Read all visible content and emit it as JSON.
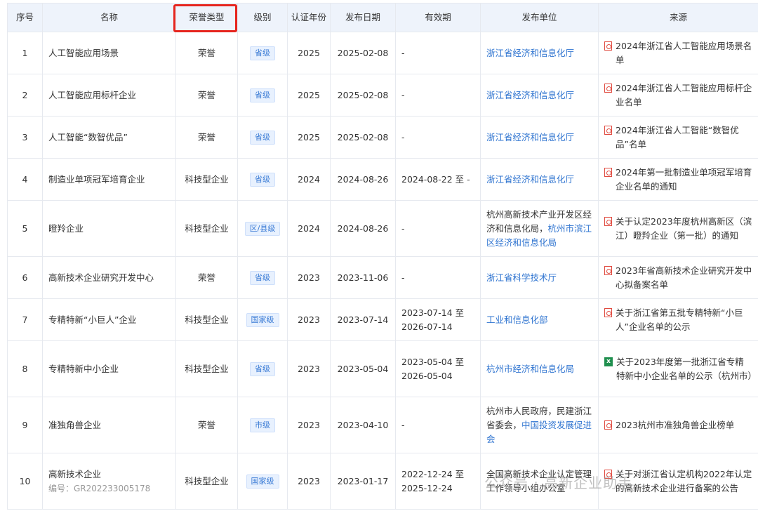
{
  "headers": [
    "序号",
    "名称",
    "荣誉类型",
    "级别",
    "认证年份",
    "发布日期",
    "有效期",
    "发布单位",
    "来源"
  ],
  "rows": [
    {
      "idx": "1",
      "name": "人工智能应用场景",
      "type": "荣誉",
      "level": "省级",
      "year": "2025",
      "date": "2025-02-08",
      "valid": "-",
      "issuer_plain": "",
      "issuer_link": "浙江省经济和信息化厅",
      "source_icon": "pdf-icon",
      "source": "2024年浙江省人工智能应用场景名单"
    },
    {
      "idx": "2",
      "name": "人工智能应用标杆企业",
      "type": "荣誉",
      "level": "省级",
      "year": "2025",
      "date": "2025-02-08",
      "valid": "-",
      "issuer_plain": "",
      "issuer_link": "浙江省经济和信息化厅",
      "source_icon": "pdf-icon",
      "source": "2024年浙江省人工智能应用标杆企业名单"
    },
    {
      "idx": "3",
      "name": "人工智能“数智优品”",
      "type": "荣誉",
      "level": "省级",
      "year": "2025",
      "date": "2025-02-08",
      "valid": "-",
      "issuer_plain": "",
      "issuer_link": "浙江省经济和信息化厅",
      "source_icon": "pdf-icon",
      "source": "2024年浙江省人工智能“数智优品”名单"
    },
    {
      "idx": "4",
      "name": "制造业单项冠军培育企业",
      "type": "科技型企业",
      "level": "省级",
      "year": "2024",
      "date": "2024-08-26",
      "valid": "2024-08-22 至 -",
      "issuer_plain": "",
      "issuer_link": "浙江省经济和信息化厅",
      "source_icon": "pdf-icon",
      "source": "2024年第一批制造业单项冠军培育企业名单的通知"
    },
    {
      "idx": "5",
      "name": "瞪羚企业",
      "type": "科技型企业",
      "level": "区/县级",
      "year": "2024",
      "date": "2024-08-26",
      "valid": "-",
      "issuer_plain": "杭州高新技术产业开发区经济和信息化局，",
      "issuer_link": "杭州市滨江区经济和信息化局",
      "source_icon": "pdf-icon",
      "source": "关于认定2023年度杭州高新区（滨江）瞪羚企业（第一批）的通知"
    },
    {
      "idx": "6",
      "name": "高新技术企业研究开发中心",
      "type": "荣誉",
      "level": "省级",
      "year": "2023",
      "date": "2023-11-06",
      "valid": "-",
      "issuer_plain": "",
      "issuer_link": "浙江省科学技术厅",
      "source_icon": "pdf-icon",
      "source": "2023年省高新技术企业研究开发中心拟备案名单"
    },
    {
      "idx": "7",
      "name": "专精特新“小巨人”企业",
      "type": "科技型企业",
      "level": "国家级",
      "year": "2023",
      "date": "2023-07-14",
      "valid": "2023-07-14 至 2026-07-14",
      "issuer_plain": "",
      "issuer_link": "工业和信息化部",
      "source_icon": "pdf-icon",
      "source": "关于浙江省第五批专精特新“小巨人”企业名单的公示"
    },
    {
      "idx": "8",
      "name": "专精特新中小企业",
      "type": "科技型企业",
      "level": "省级",
      "year": "2023",
      "date": "2023-05-04",
      "valid": "2023-05-04 至 2026-05-04",
      "issuer_plain": "",
      "issuer_link": "杭州市经济和信息化局",
      "source_icon": "xls-icon",
      "source": "关于2023年度第一批浙江省专精特新中小企业名单的公示（杭州市）"
    },
    {
      "idx": "9",
      "name": "准独角兽企业",
      "type": "荣誉",
      "level": "市级",
      "year": "2023",
      "date": "2023-04-10",
      "valid": "-",
      "issuer_plain": "杭州市人民政府，民建浙江省委会，",
      "issuer_link": "中国投资发展促进会",
      "source_icon": "pdf-icon",
      "source": "2023杭州市准独角兽企业榜单"
    },
    {
      "idx": "10",
      "name": "高新技术企业",
      "sub": "编号：GR202233005178",
      "type": "科技型企业",
      "level": "国家级",
      "year": "2023",
      "date": "2023-01-17",
      "valid": "2022-12-24 至 2025-12-24",
      "issuer_plain": "全国高新技术企业认定管理工作领导小组办公室",
      "issuer_link": "",
      "source_icon": "pdf-icon",
      "source": "关于对浙江省认定机构2022年认定的高新技术企业进行备案的公告"
    }
  ],
  "watermark": "公众号 · 高新企业助手",
  "colors": {
    "highlight": "#e6251e",
    "link": "#2f74d0",
    "header_bg": "#eef3fb"
  }
}
